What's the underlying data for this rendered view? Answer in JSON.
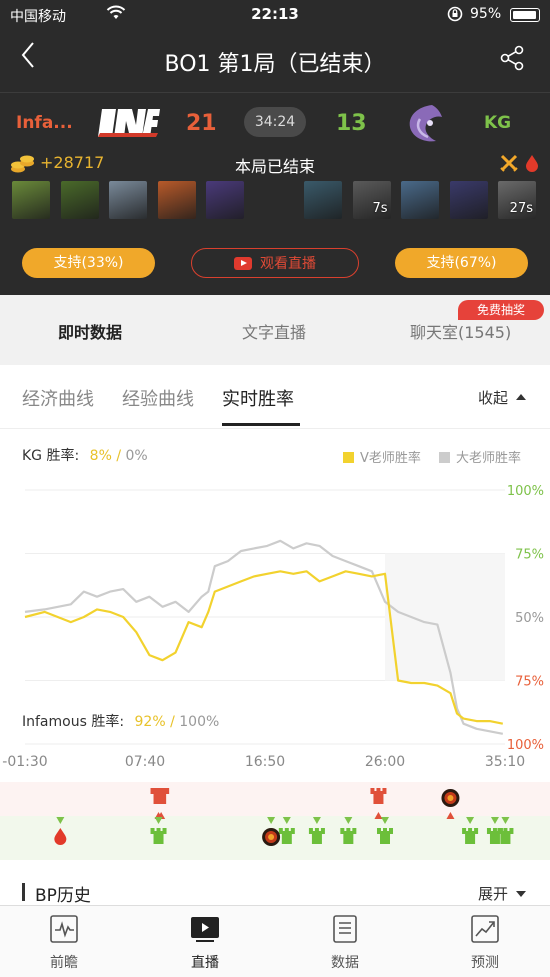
{
  "status_bar": {
    "carrier": "中国移动",
    "time": "22:13",
    "battery": "95%"
  },
  "nav": {
    "title": "BO1   第1局（已结束）",
    "back_icon": "chevron-left-icon",
    "share_icon": "share-icon"
  },
  "match": {
    "team_left": {
      "name": "Infa...",
      "logo_text": "INF",
      "score": "21",
      "color": "#e8603a"
    },
    "team_right": {
      "name": "KG",
      "score": "13",
      "color": "#7ec24a"
    },
    "duration": "34:24",
    "gold_diff": "+28717",
    "status": "本局已结束"
  },
  "heroes": {
    "left": [
      {
        "name": "hero-1",
        "color": "#6a8a3a"
      },
      {
        "name": "hero-2",
        "color": "#4a6a2a"
      },
      {
        "name": "hero-3",
        "color": "#7a8a9a"
      },
      {
        "name": "hero-4",
        "color": "#b85a2a"
      },
      {
        "name": "hero-5",
        "color": "#4a3a7a"
      }
    ],
    "right": [
      {
        "name": "hero-6",
        "color": "#3a5a6a",
        "timer": ""
      },
      {
        "name": "hero-7",
        "color": "#5a5a5a",
        "timer": "7s"
      },
      {
        "name": "hero-8",
        "color": "#4a6a8a",
        "timer": ""
      },
      {
        "name": "hero-9",
        "color": "#3a3a6a",
        "timer": ""
      },
      {
        "name": "hero-10",
        "color": "#6a6a6a",
        "timer": "27s"
      }
    ]
  },
  "buttons": {
    "support_left": "支持(33%)",
    "watch_live": "观看直播",
    "support_right": "支持(67%)"
  },
  "tabs": {
    "items": [
      "即时数据",
      "文字直播",
      "聊天室(1545)"
    ],
    "active": 0,
    "lottery_badge": "免费抽奖"
  },
  "subtabs": {
    "items": [
      "经济曲线",
      "经验曲线",
      "实时胜率"
    ],
    "active": 2,
    "collapse_label": "收起"
  },
  "winrate": {
    "kg_label": "KG 胜率:",
    "kg_v": "8%",
    "kg_da": "0%",
    "inf_label": "Infamous 胜率:",
    "inf_v": "92%",
    "inf_da": "100%",
    "sep": "/",
    "legend_v": "V老师胜率",
    "legend_da": "大老师胜率",
    "legend_v_color": "#f2d22e",
    "legend_da_color": "#cccccc"
  },
  "chart_data": {
    "type": "line",
    "y_right_top_labels": [
      "100%",
      "75%",
      "50%"
    ],
    "y_right_bottom_labels": [
      "75%",
      "100%"
    ],
    "x_ticks": [
      "-01:30",
      "07:40",
      "16:50",
      "26:00",
      "35:10"
    ],
    "x_tick_minutes": [
      -1.5,
      7.667,
      16.833,
      26.0,
      35.167
    ],
    "series": [
      {
        "name": "V老师胜率",
        "color": "#f2d22e",
        "x": [
          -1.5,
          0,
          2,
          3,
          4,
          5,
          6,
          7,
          8,
          9,
          10,
          11,
          12,
          12.5,
          13,
          14,
          15,
          16,
          17,
          18,
          19,
          20,
          21,
          22,
          23,
          24,
          25,
          26,
          27,
          28,
          29,
          30,
          31,
          31.5,
          32,
          33,
          34,
          35
        ],
        "y": [
          50,
          52,
          48,
          50,
          53,
          52,
          50,
          44,
          35,
          33,
          36,
          48,
          46,
          52,
          60,
          62,
          64,
          66,
          67,
          68,
          67,
          68,
          64,
          66,
          68,
          67,
          66,
          67,
          25,
          24,
          24,
          23,
          20,
          12,
          10,
          9,
          9,
          8
        ]
      },
      {
        "name": "大老师胜率",
        "color": "#cccccc",
        "x": [
          -1.5,
          0,
          2,
          3,
          4,
          5,
          6,
          7,
          8,
          9,
          10,
          11,
          12,
          12.5,
          13,
          14,
          15,
          16,
          17,
          18,
          19,
          20,
          21,
          22,
          23,
          24,
          25,
          26,
          27,
          28,
          29,
          30,
          31,
          31.5,
          32,
          33,
          34,
          35
        ],
        "y": [
          52,
          53,
          55,
          60,
          58,
          60,
          61,
          56,
          58,
          54,
          56,
          52,
          58,
          60,
          70,
          72,
          76,
          77,
          78,
          80,
          77,
          79,
          78,
          74,
          72,
          70,
          68,
          56,
          52,
          50,
          48,
          47,
          28,
          14,
          8,
          6,
          5,
          4
        ]
      }
    ],
    "grid": true
  },
  "events": {
    "top_towers": [
      8.7,
      8.9,
      25.5
    ],
    "top_roshan": [
      31.0
    ],
    "bottom_blood": [
      1.2
    ],
    "bottom_towers": [
      8.7,
      18.5,
      20.8,
      23.2,
      26.0,
      32.5,
      34.4,
      35.2
    ],
    "bottom_roshan": [
      17.3
    ]
  },
  "bp": {
    "label": "BP历史",
    "expand_label": "展开"
  },
  "bottom_nav": {
    "items": [
      "前瞻",
      "直播",
      "数据",
      "预测"
    ],
    "active": 1
  }
}
